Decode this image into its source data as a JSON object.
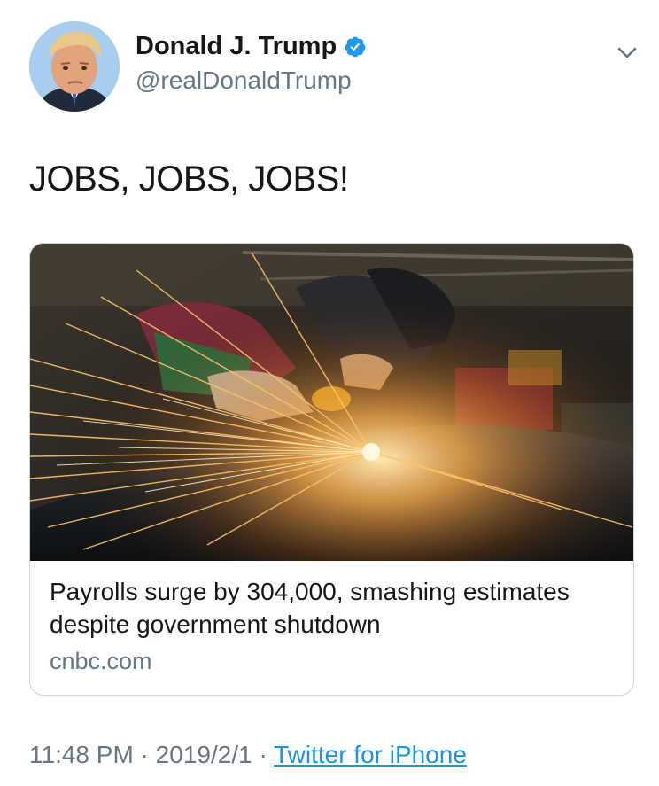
{
  "tweet": {
    "author": {
      "name": "Donald J. Trump",
      "handle": "@realDonaldTrump",
      "verified": true
    },
    "text": "JOBS, JOBS, JOBS!",
    "card": {
      "title": "Payrolls surge by 304,000, smashing estimates despite government shutdown",
      "domain": "cnbc.com"
    },
    "time": "11:48 PM",
    "separator1": " · ",
    "date": "2019/2/1",
    "separator2": " · ",
    "source": "Twitter for iPhone"
  },
  "colors": {
    "verified_badge": "#1d9bf0",
    "link": "#1b95e0",
    "muted_text": "#657786",
    "border": "#ccd6dd"
  },
  "icons": {
    "verified": "verified-badge-icon",
    "menu": "chevron-down-icon"
  }
}
